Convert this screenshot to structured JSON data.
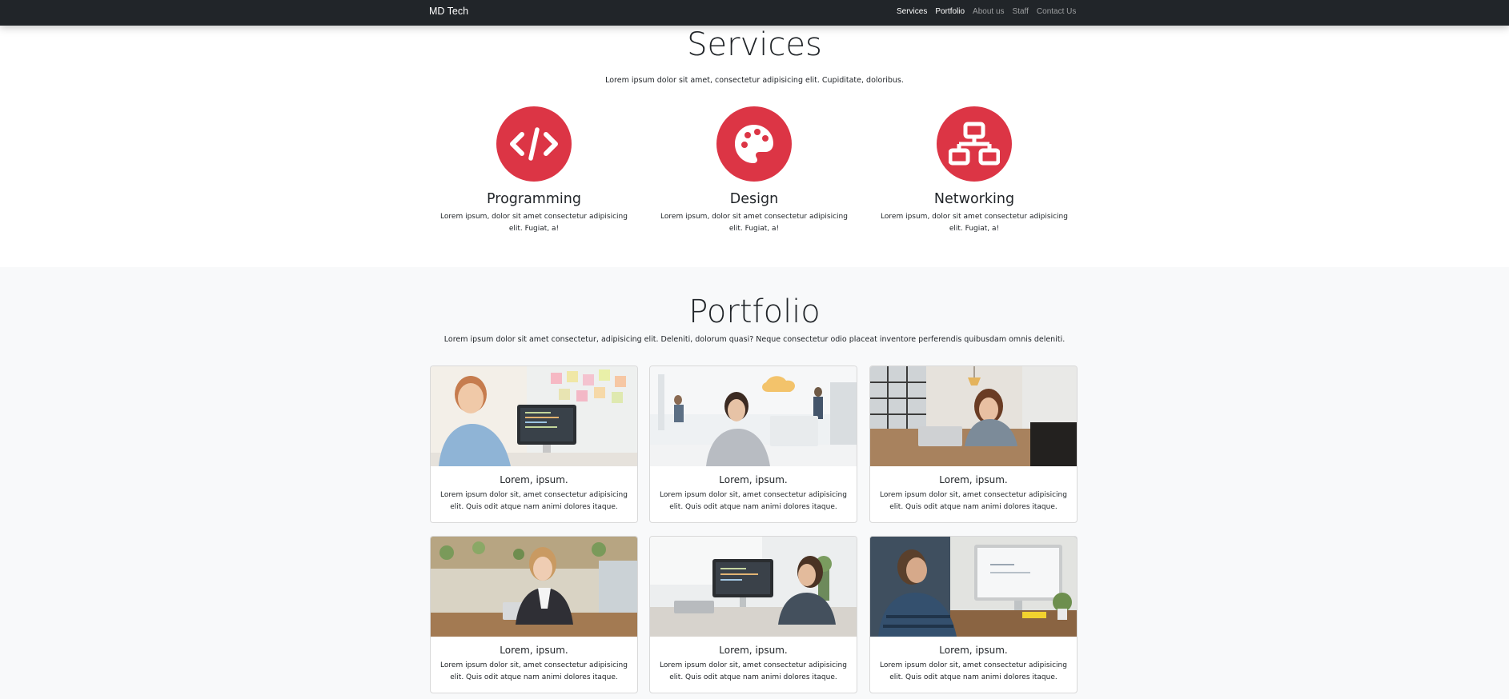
{
  "navbar": {
    "brand": "MD Tech",
    "links": [
      {
        "label": "Services",
        "active": true
      },
      {
        "label": "Portfolio",
        "active": false
      },
      {
        "label": "About us",
        "active": false
      },
      {
        "label": "Staff",
        "active": false
      },
      {
        "label": "Contact Us",
        "active": false
      }
    ]
  },
  "services": {
    "title": "Services",
    "subtitle": "Lorem ipsum dolor sit amet, consectetur adipisicing elit. Cupiditate, doloribus.",
    "accent_color": "#dc3545",
    "items": [
      {
        "icon": "code-icon",
        "title": "Programming",
        "text": "Lorem ipsum, dolor sit amet consectetur adipisicing elit. Fugiat, a!"
      },
      {
        "icon": "palette-icon",
        "title": "Design",
        "text": "Lorem ipsum, dolor sit amet consectetur adipisicing elit. Fugiat, a!"
      },
      {
        "icon": "network-icon",
        "title": "Networking",
        "text": "Lorem ipsum, dolor sit amet consectetur adipisicing elit. Fugiat, a!"
      }
    ]
  },
  "portfolio": {
    "title": "Portfolio",
    "subtitle": "Lorem ipsum dolor sit amet consectetur, adipisicing elit. Deleniti, dolorum quasi? Neque consectetur odio placeat inventore perferendis quibusdam omnis deleniti.",
    "cards": [
      {
        "title": "Lorem, ipsum.",
        "text": "Lorem ipsum dolor sit, amet consectetur adipisicing elit. Quis odit atque nam animi dolores itaque."
      },
      {
        "title": "Lorem, ipsum.",
        "text": "Lorem ipsum dolor sit, amet consectetur adipisicing elit. Quis odit atque nam animi dolores itaque."
      },
      {
        "title": "Lorem, ipsum.",
        "text": "Lorem ipsum dolor sit, amet consectetur adipisicing elit. Quis odit atque nam animi dolores itaque."
      },
      {
        "title": "Lorem, ipsum.",
        "text": "Lorem ipsum dolor sit, amet consectetur adipisicing elit. Quis odit atque nam animi dolores itaque."
      },
      {
        "title": "Lorem, ipsum.",
        "text": "Lorem ipsum dolor sit, amet consectetur adipisicing elit. Quis odit atque nam animi dolores itaque."
      },
      {
        "title": "Lorem, ipsum.",
        "text": "Lorem ipsum dolor sit, amet consectetur adipisicing elit. Quis odit atque nam animi dolores itaque."
      }
    ]
  }
}
